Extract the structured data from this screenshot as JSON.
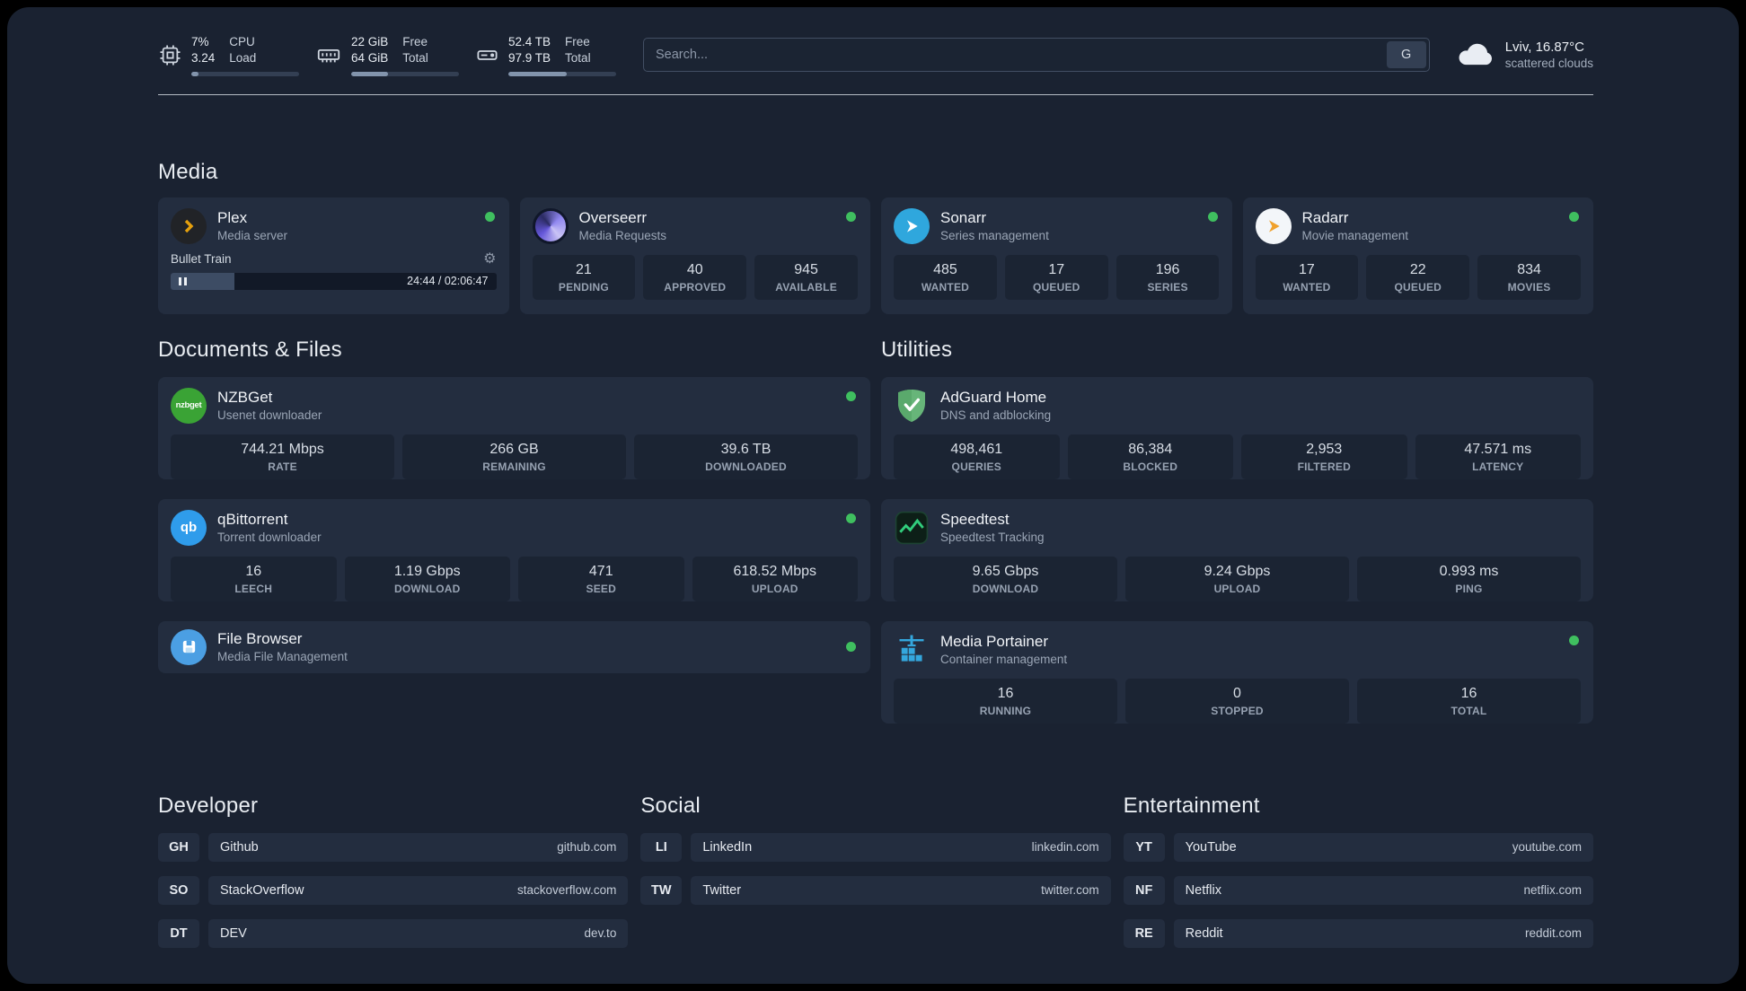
{
  "colors": {
    "background": "#1a2231",
    "card": "#232d3f",
    "tile": "#1b2433",
    "status_green": "#3fbf5f",
    "plex_orange": "#e5a00d",
    "sonarr_blue": "#2fa7dd",
    "radarr_orange": "#f0a12c",
    "nzbget_green": "#3aa335",
    "qbittorrent_blue": "#2f9ceb",
    "adguard_green": "#67b579",
    "speedtest_green": "#31cd7c",
    "portainer_blue": "#34a7dd"
  },
  "icons": {
    "gear": "⚙",
    "search_engine": "G"
  },
  "topbar": {
    "cpu": {
      "value_top": "7%",
      "value_bottom": "3.24",
      "label_top": "CPU",
      "label_bottom": "Load",
      "progress": 7
    },
    "ram": {
      "value_top": "22 GiB",
      "value_bottom": "64 GiB",
      "label_top": "Free",
      "label_bottom": "Total",
      "progress": 34
    },
    "disk": {
      "value_top": "52.4 TB",
      "value_bottom": "97.9 TB",
      "label_top": "Free",
      "label_bottom": "Total",
      "progress": 54
    },
    "search": {
      "placeholder": "Search...",
      "button": "G"
    },
    "weather": {
      "location": "Lviv, 16.87°C",
      "condition": "scattered clouds"
    }
  },
  "sections": {
    "media": {
      "title": "Media"
    },
    "documents": {
      "title": "Documents & Files"
    },
    "utilities": {
      "title": "Utilities"
    },
    "developer": {
      "title": "Developer"
    },
    "social": {
      "title": "Social"
    },
    "entertainment": {
      "title": "Entertainment"
    }
  },
  "apps": {
    "plex": {
      "name": "Plex",
      "desc": "Media server",
      "status": "online",
      "now_playing": "Bullet Train",
      "time": "24:44 / 02:06:47",
      "progress_pct": 19.5
    },
    "overseerr": {
      "name": "Overseerr",
      "desc": "Media Requests",
      "status": "online",
      "stats": [
        {
          "value": "21",
          "label": "PENDING"
        },
        {
          "value": "40",
          "label": "APPROVED"
        },
        {
          "value": "945",
          "label": "AVAILABLE"
        }
      ]
    },
    "sonarr": {
      "name": "Sonarr",
      "desc": "Series management",
      "status": "online",
      "stats": [
        {
          "value": "485",
          "label": "WANTED"
        },
        {
          "value": "17",
          "label": "QUEUED"
        },
        {
          "value": "196",
          "label": "SERIES"
        }
      ]
    },
    "radarr": {
      "name": "Radarr",
      "desc": "Movie management",
      "status": "online",
      "stats": [
        {
          "value": "17",
          "label": "WANTED"
        },
        {
          "value": "22",
          "label": "QUEUED"
        },
        {
          "value": "834",
          "label": "MOVIES"
        }
      ]
    },
    "nzbget": {
      "name": "NZBGet",
      "desc": "Usenet downloader",
      "status": "online",
      "icon_text": "nzbget",
      "stats": [
        {
          "value": "744.21 Mbps",
          "label": "RATE"
        },
        {
          "value": "266 GB",
          "label": "REMAINING"
        },
        {
          "value": "39.6 TB",
          "label": "DOWNLOADED"
        }
      ]
    },
    "qbittorrent": {
      "name": "qBittorrent",
      "desc": "Torrent downloader",
      "status": "online",
      "icon_text": "qb",
      "stats": [
        {
          "value": "16",
          "label": "LEECH"
        },
        {
          "value": "1.19 Gbps",
          "label": "DOWNLOAD"
        },
        {
          "value": "471",
          "label": "SEED"
        },
        {
          "value": "618.52 Mbps",
          "label": "UPLOAD"
        }
      ]
    },
    "filebrowser": {
      "name": "File Browser",
      "desc": "Media File Management",
      "status": "online"
    },
    "adguard": {
      "name": "AdGuard Home",
      "desc": "DNS and adblocking",
      "stats": [
        {
          "value": "498,461",
          "label": "QUERIES"
        },
        {
          "value": "86,384",
          "label": "BLOCKED"
        },
        {
          "value": "2,953",
          "label": "FILTERED"
        },
        {
          "value": "47.571 ms",
          "label": "LATENCY"
        }
      ]
    },
    "speedtest": {
      "name": "Speedtest",
      "desc": "Speedtest Tracking",
      "stats": [
        {
          "value": "9.65 Gbps",
          "label": "DOWNLOAD"
        },
        {
          "value": "9.24 Gbps",
          "label": "UPLOAD"
        },
        {
          "value": "0.993 ms",
          "label": "PING"
        }
      ]
    },
    "portainer": {
      "name": "Media Portainer",
      "desc": "Container management",
      "status": "online",
      "stats": [
        {
          "value": "16",
          "label": "RUNNING"
        },
        {
          "value": "0",
          "label": "STOPPED"
        },
        {
          "value": "16",
          "label": "TOTAL"
        }
      ]
    }
  },
  "links": {
    "developer": [
      {
        "abbr": "GH",
        "name": "Github",
        "url": "github.com"
      },
      {
        "abbr": "SO",
        "name": "StackOverflow",
        "url": "stackoverflow.com"
      },
      {
        "abbr": "DT",
        "name": "DEV",
        "url": "dev.to"
      }
    ],
    "social": [
      {
        "abbr": "LI",
        "name": "LinkedIn",
        "url": "linkedin.com"
      },
      {
        "abbr": "TW",
        "name": "Twitter",
        "url": "twitter.com"
      }
    ],
    "entertainment": [
      {
        "abbr": "YT",
        "name": "YouTube",
        "url": "youtube.com"
      },
      {
        "abbr": "NF",
        "name": "Netflix",
        "url": "netflix.com"
      },
      {
        "abbr": "RE",
        "name": "Reddit",
        "url": "reddit.com"
      }
    ]
  }
}
